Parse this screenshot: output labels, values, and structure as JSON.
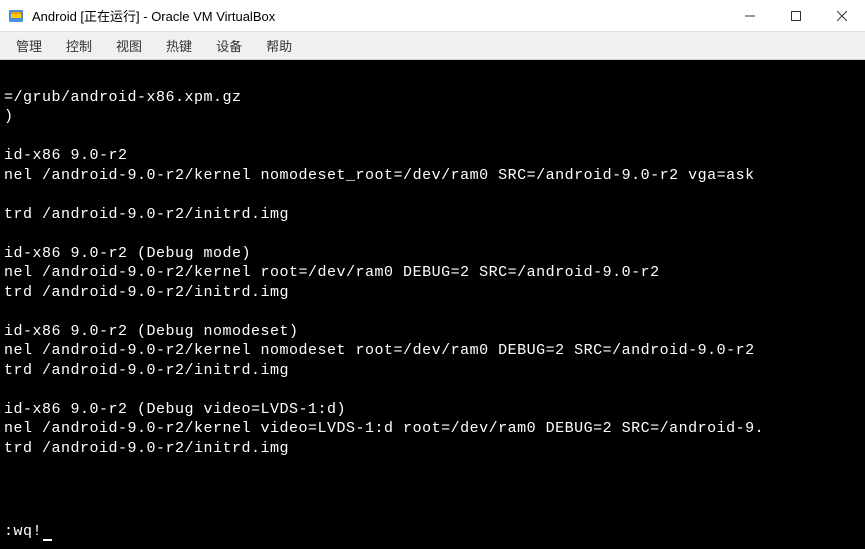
{
  "titlebar": {
    "title": "Android [正在运行] - Oracle VM VirtualBox"
  },
  "menubar": {
    "items": [
      {
        "label": "管理"
      },
      {
        "label": "控制"
      },
      {
        "label": "视图"
      },
      {
        "label": "热键"
      },
      {
        "label": "设备"
      },
      {
        "label": "帮助"
      }
    ]
  },
  "terminal": {
    "lines": [
      "",
      "=/grub/android-x86.xpm.gz",
      ")",
      "",
      "id-x86 9.0-r2",
      "nel /android-9.0-r2/kernel nomodeset_root=/dev/ram0 SRC=/android-9.0-r2 vga=ask",
      "",
      "trd /android-9.0-r2/initrd.img",
      "",
      "id-x86 9.0-r2 (Debug mode)",
      "nel /android-9.0-r2/kernel root=/dev/ram0 DEBUG=2 SRC=/android-9.0-r2",
      "trd /android-9.0-r2/initrd.img",
      "",
      "id-x86 9.0-r2 (Debug nomodeset)",
      "nel /android-9.0-r2/kernel nomodeset root=/dev/ram0 DEBUG=2 SRC=/android-9.0-r2",
      "trd /android-9.0-r2/initrd.img",
      "",
      "id-x86 9.0-r2 (Debug video=LVDS-1:d)",
      "nel /android-9.0-r2/kernel video=LVDS-1:d root=/dev/ram0 DEBUG=2 SRC=/android-9.",
      "trd /android-9.0-r2/initrd.img",
      ""
    ],
    "command": ":wq!"
  }
}
